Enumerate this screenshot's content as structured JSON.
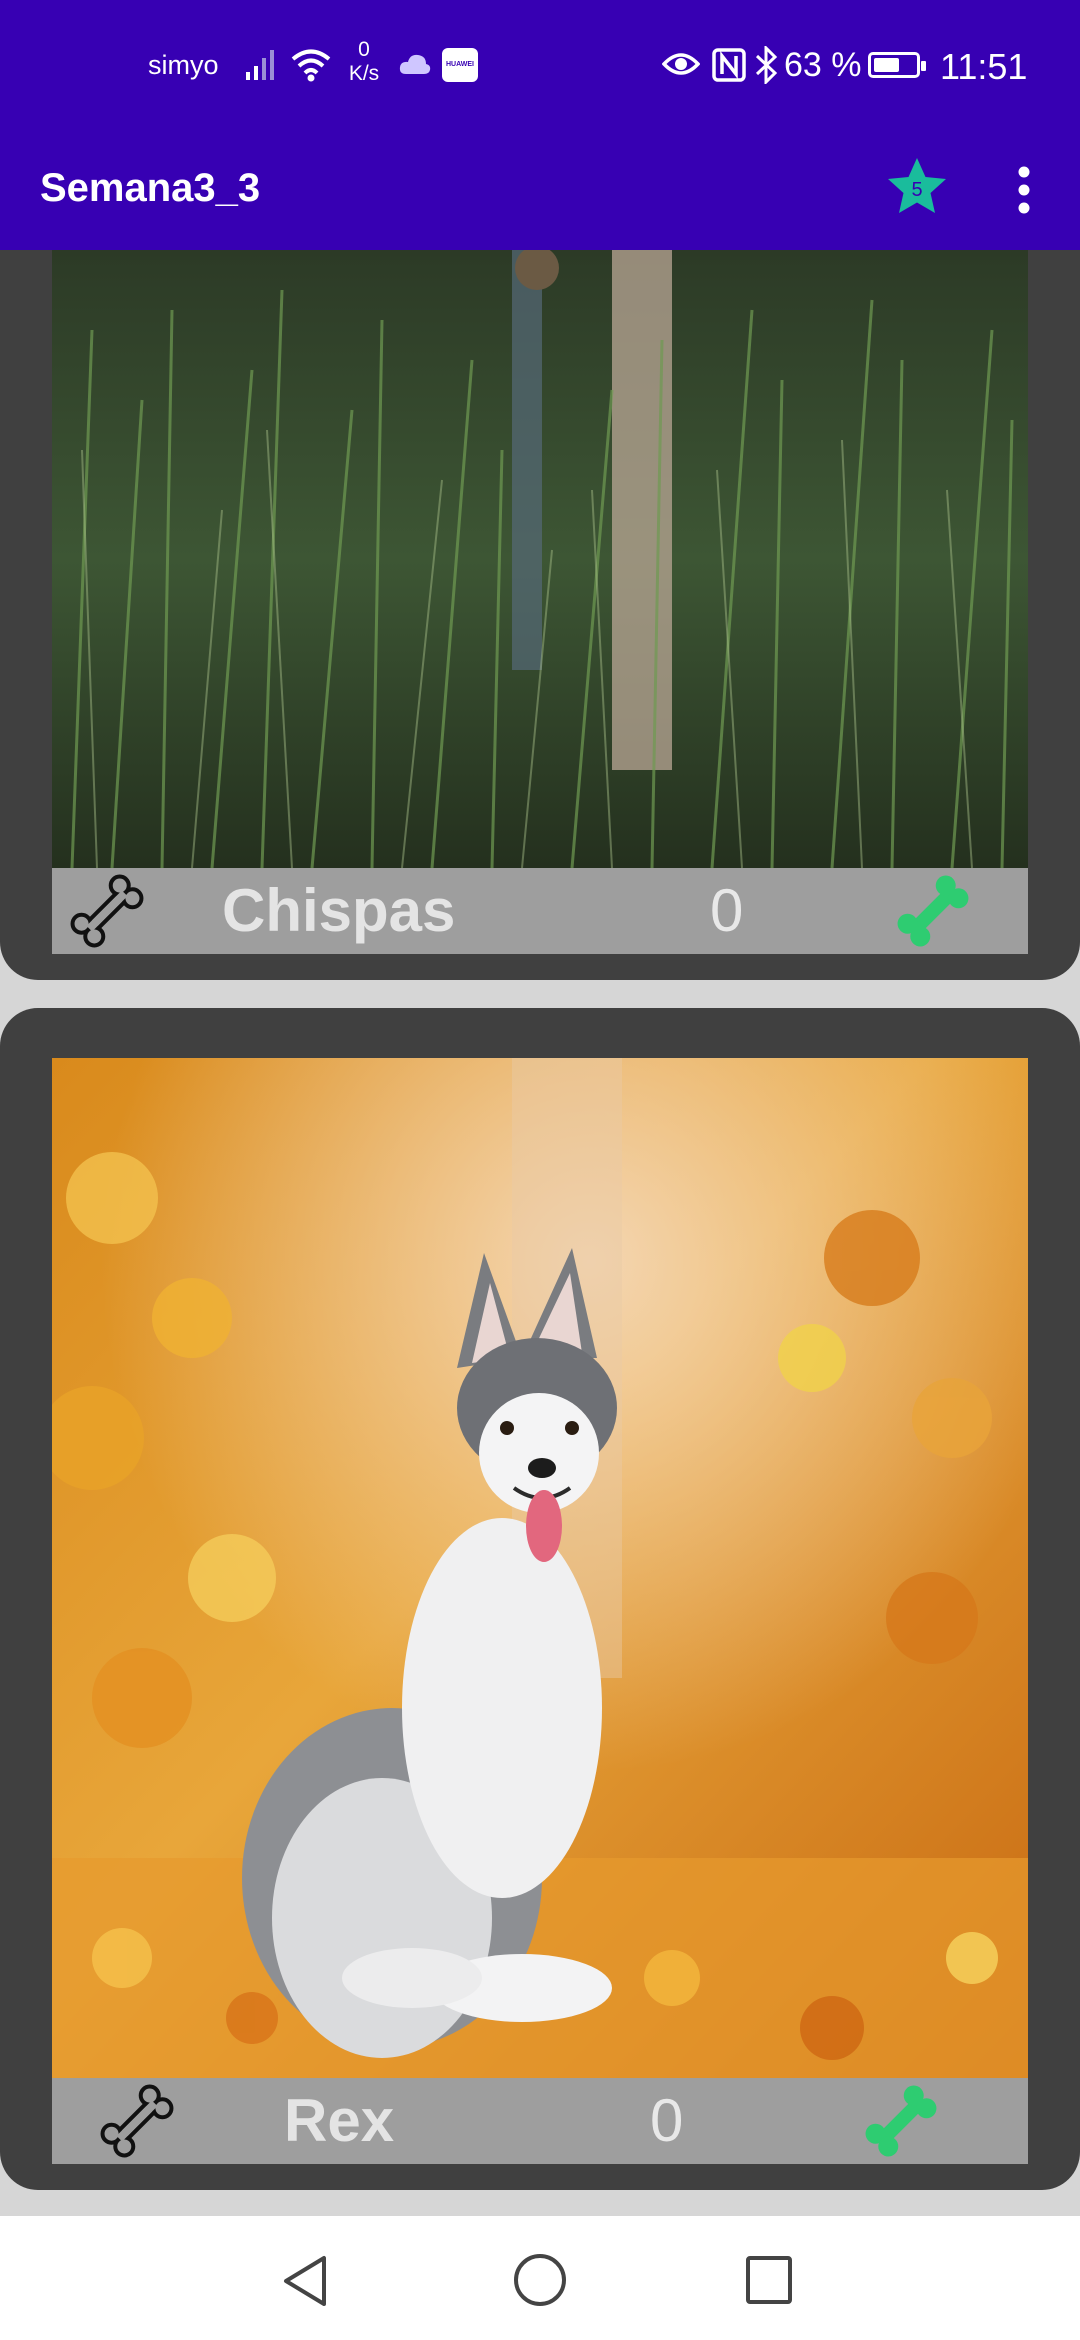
{
  "status_bar": {
    "carrier": "simyo",
    "speed_value": "0",
    "speed_unit": "K/s",
    "huawei_badge": "HUAWEI",
    "battery_percent": "63 %",
    "battery_level": 0.63,
    "time": "11:51",
    "icons": [
      "signal-icon",
      "wifi-icon",
      "cloud-icon",
      "huawei-store-icon",
      "eye-icon",
      "nfc-icon",
      "bluetooth-icon",
      "battery-icon"
    ]
  },
  "app_bar": {
    "title": "Semana3_3",
    "favorites_badge": "5",
    "star_color": "#1abc9c",
    "menu_icon": "more-vert-icon"
  },
  "pets": [
    {
      "name": "Chispas",
      "count": "0",
      "photo": "dog standing in tall green grass"
    },
    {
      "name": "Rex",
      "count": "0",
      "photo": "husky sitting on autumn leaves"
    }
  ],
  "colors": {
    "primary": "#3700b3",
    "card": "#404040",
    "info_bar": "#9e9e9e",
    "bone_accent": "#2ecc71"
  },
  "nav_bar": {
    "icons": [
      "back-icon",
      "home-icon",
      "recent-apps-icon"
    ]
  }
}
